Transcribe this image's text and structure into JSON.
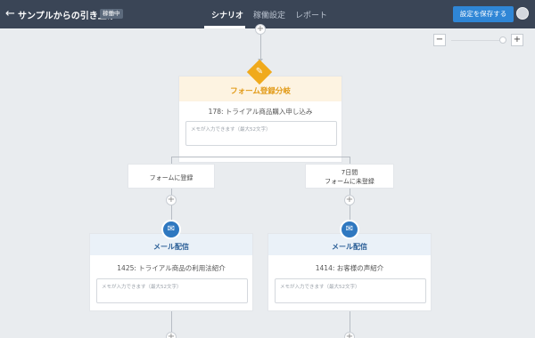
{
  "header": {
    "title": "サンプルからの引き上げ",
    "status_badge": "稼働中",
    "tabs": [
      {
        "label": "シナリオ",
        "active": true
      },
      {
        "label": "稼働設定",
        "active": false
      },
      {
        "label": "レポート",
        "active": false
      }
    ],
    "save_label": "設定を保存する"
  },
  "zoom": {
    "minus": "−",
    "plus": "+"
  },
  "branch_node": {
    "title": "フォーム登録分岐",
    "form": "178: トライアル商品購入申し込み",
    "memo_placeholder": "メモが入力できます（最大52文字）",
    "icon": "form-branch-icon"
  },
  "conditions": {
    "left": {
      "line1": "フォームに登録"
    },
    "right": {
      "line1": "7日間",
      "line2": "フォームに未登録"
    }
  },
  "mail_nodes": [
    {
      "title": "メール配信",
      "mail": "1425: トライアル商品の利用法紹介",
      "memo_placeholder": "メモが入力できます（最大52文字）"
    },
    {
      "title": "メール配信",
      "mail": "1414: お客様の声紹介",
      "memo_placeholder": "メモが入力できます（最大52文字）"
    }
  ],
  "colors": {
    "topbar": "#3a4556",
    "accent_blue": "#2f86d6",
    "branch_orange": "#f0aa1c",
    "mail_blue": "#2f78c0"
  },
  "icons": {
    "back": "back-arrow-icon",
    "mail": "envelope-icon",
    "add": "plus-icon"
  }
}
